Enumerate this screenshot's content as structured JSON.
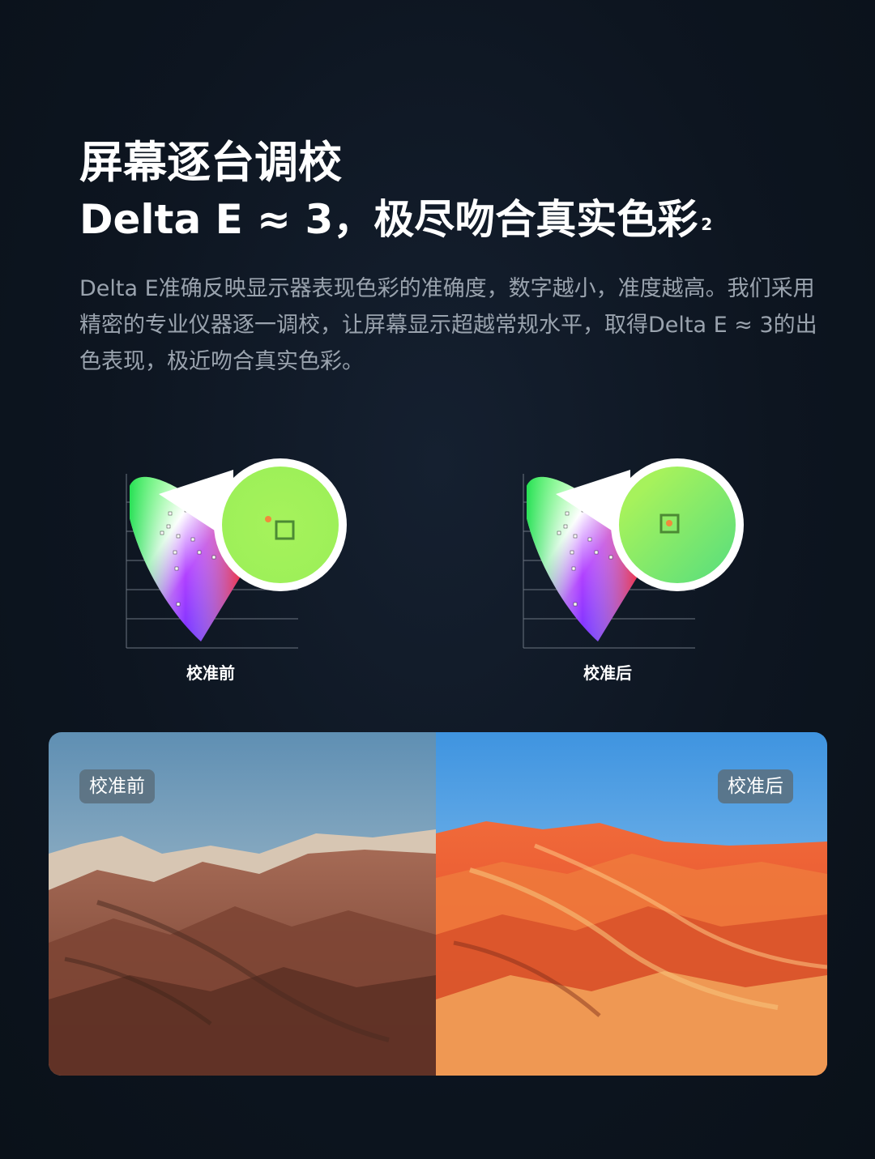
{
  "header": {
    "title_line1": "屏幕逐台调校",
    "title_line2": "Delta E ≈ 3，极尽吻合真实色彩",
    "title_footnote": "2",
    "description": "Delta E准确反映显示器表现色彩的准确度，数字越小，准度越高。我们采用精密的专业仪器逐一调校，让屏幕显示超越常规水平，取得Delta E ≈ 3的出色表现，极近吻合真实色彩。"
  },
  "gamut_before": {
    "caption": "校准前"
  },
  "gamut_after": {
    "caption": "校准后"
  },
  "photo": {
    "before_label": "校准前",
    "after_label": "校准后"
  },
  "colors": {
    "background": "#0d1520",
    "accent_green": "#a6f25c",
    "marker_orange": "#f08a3c"
  }
}
